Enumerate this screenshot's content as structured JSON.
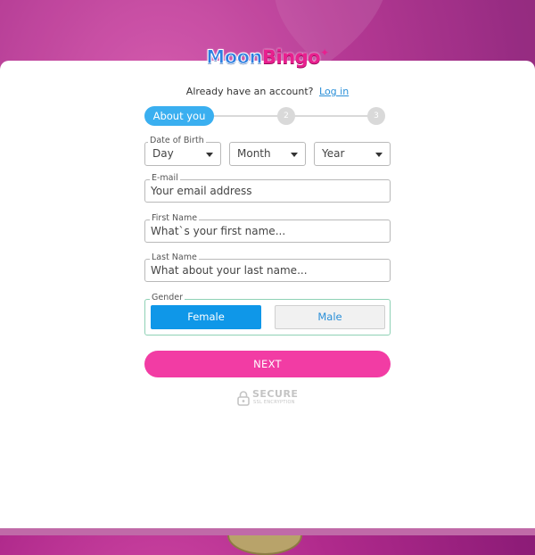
{
  "brand": {
    "moon": "Moon",
    "bingo": "Bingo"
  },
  "account": {
    "prompt": "Already have an account?",
    "login_link": "Log in"
  },
  "steps": {
    "active_label": "About you",
    "step2": "2",
    "step3": "3"
  },
  "dob": {
    "legend": "Date of Birth",
    "day": "Day",
    "month": "Month",
    "year": "Year"
  },
  "email": {
    "label": "E-mail",
    "placeholder": "Your email address"
  },
  "first_name": {
    "label": "First Name",
    "placeholder": "What`s your first name..."
  },
  "last_name": {
    "label": "Last Name",
    "placeholder": "What about your last name..."
  },
  "gender": {
    "label": "Gender",
    "female": "Female",
    "male": "Male",
    "selected": "Female"
  },
  "next_label": "NEXT",
  "secure": {
    "title": "SECURE",
    "subtitle": "SSL ENCRYPTION"
  },
  "colors": {
    "primary_blue": "#0f97e8",
    "step_blue": "#3aaff0",
    "next_pink": "#f23ca4",
    "link_blue": "#2a8fd8",
    "gender_border": "#8fd1b5"
  }
}
